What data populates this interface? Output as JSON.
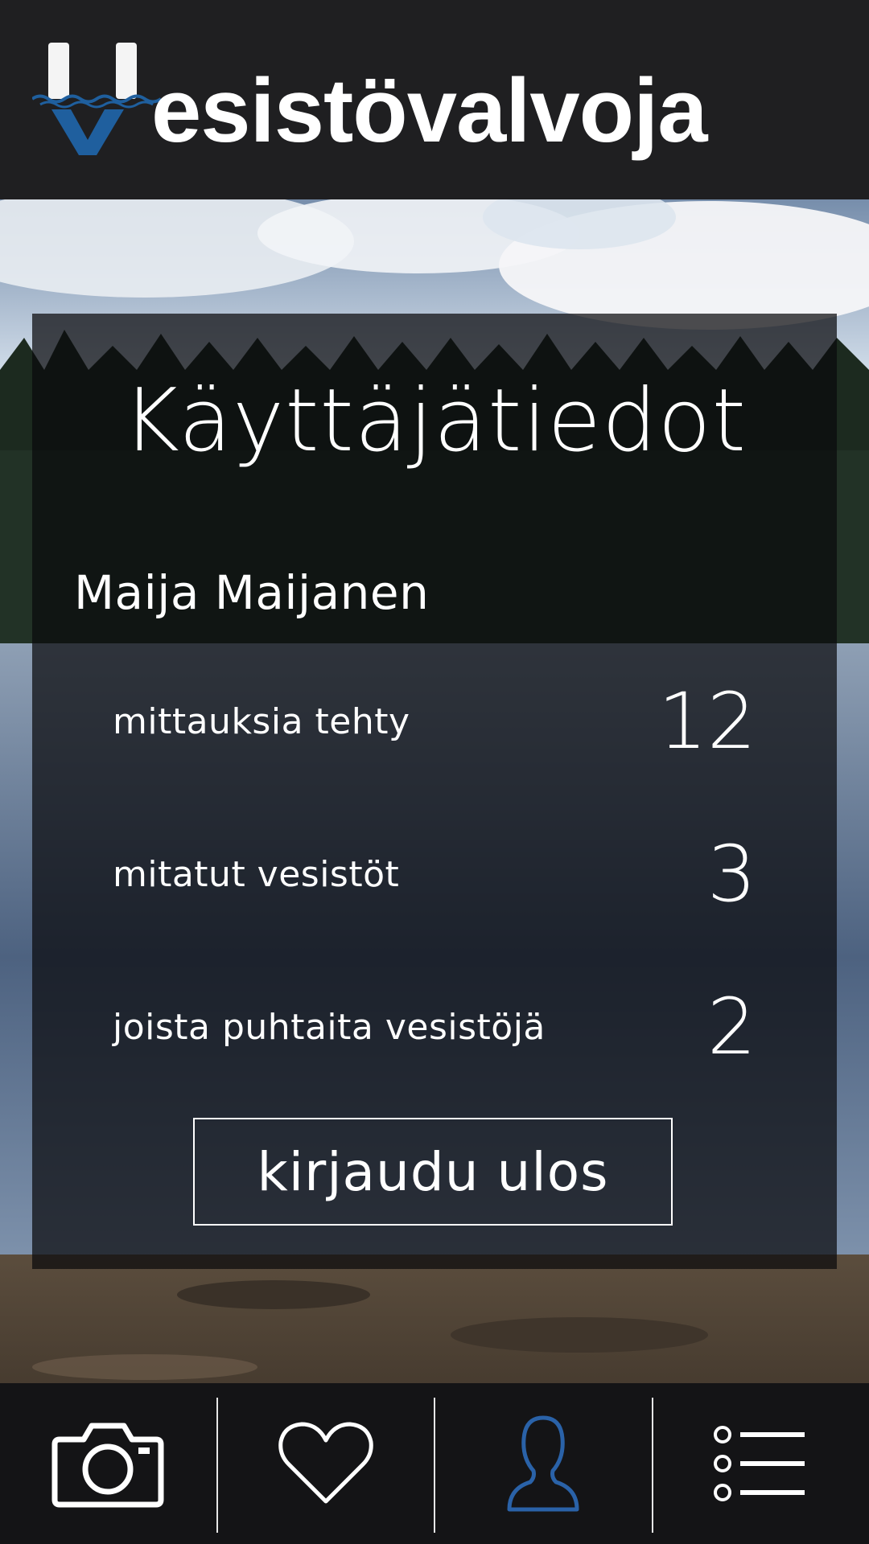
{
  "app": {
    "brand_text": "esistövalvoja",
    "logo_letter": "V"
  },
  "profile": {
    "title": "Käyttäjätiedot",
    "user_name": "Maija Maijanen",
    "stats": [
      {
        "label": "mittauksia tehty",
        "value": "12"
      },
      {
        "label": "mitatut vesistöt",
        "value": "3"
      },
      {
        "label": "joista puhtaita vesistöjä",
        "value": "2"
      }
    ],
    "logout_label": "kirjaudu ulos"
  },
  "nav": {
    "items": [
      {
        "icon": "camera-icon",
        "active": false
      },
      {
        "icon": "heart-icon",
        "active": false
      },
      {
        "icon": "user-icon",
        "active": true
      },
      {
        "icon": "list-icon",
        "active": false
      }
    ],
    "active_color": "#2a62a8"
  },
  "colors": {
    "logo_blue": "#1f5f9e",
    "header_bg": "#1f1f21"
  }
}
